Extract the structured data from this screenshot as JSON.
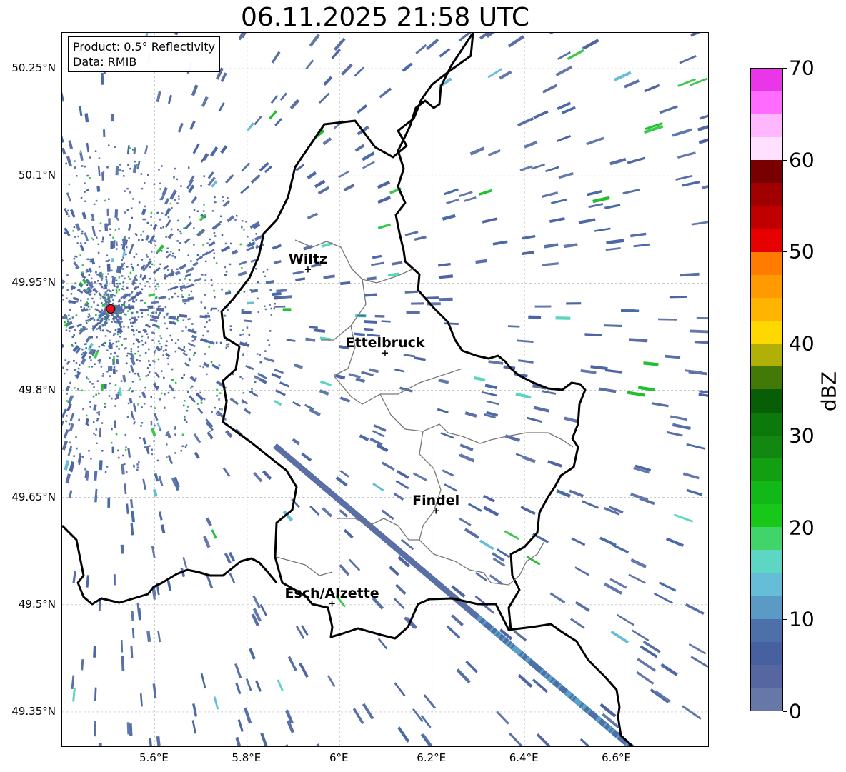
{
  "title": "06.11.2025 21:58 UTC",
  "info": {
    "product": "Product: 0.5° Reflectivity",
    "data": "Data: RMIB"
  },
  "map": {
    "lon_range": [
      5.4,
      6.8
    ],
    "lat_range": [
      49.3,
      50.3
    ],
    "y_ticks": [
      {
        "lat": 50.25,
        "label": "50.25°N"
      },
      {
        "lat": 50.1,
        "label": "50.1°N"
      },
      {
        "lat": 49.95,
        "label": "49.95°N"
      },
      {
        "lat": 49.8,
        "label": "49.8°N"
      },
      {
        "lat": 49.65,
        "label": "49.65°N"
      },
      {
        "lat": 49.5,
        "label": "49.5°N"
      },
      {
        "lat": 49.35,
        "label": "49.35°N"
      }
    ],
    "x_ticks": [
      {
        "lon": 5.6,
        "label": "5.6°E"
      },
      {
        "lon": 5.8,
        "label": "5.8°E"
      },
      {
        "lon": 6.0,
        "label": "6°E"
      },
      {
        "lon": 6.2,
        "label": "6.2°E"
      },
      {
        "lon": 6.4,
        "label": "6.4°E"
      },
      {
        "lon": 6.6,
        "label": "6.6°E"
      }
    ],
    "cities": [
      {
        "name": "Wiltz",
        "lon": 5.933,
        "lat": 49.967
      },
      {
        "name": "Ettelbruck",
        "lon": 6.1,
        "lat": 49.85
      },
      {
        "name": "Findel",
        "lon": 6.21,
        "lat": 49.63
      },
      {
        "name": "Esch/Alzette",
        "lon": 5.985,
        "lat": 49.5
      }
    ],
    "radar_site": {
      "lon": 5.505,
      "lat": 49.914,
      "color": "#e8101a"
    }
  },
  "colorbar": {
    "label": "dBZ",
    "ticks": [
      "0",
      "10",
      "20",
      "30",
      "40",
      "50",
      "60",
      "70"
    ],
    "min": 0,
    "max": 70,
    "colors": [
      "#6677a8",
      "#5566a0",
      "#4760a0",
      "#4d70a8",
      "#5a9ac4",
      "#66bdd8",
      "#5dd6c4",
      "#40d46a",
      "#18c818",
      "#12b818",
      "#12a012",
      "#128812",
      "#0b7a0b",
      "#075e07",
      "#437a07",
      "#b0b008",
      "#ffd800",
      "#ffb400",
      "#ff9a00",
      "#ff7c00",
      "#e60000",
      "#c00000",
      "#a00000",
      "#780000",
      "#ffe0ff",
      "#ffb8ff",
      "#ff6cff",
      "#e836e8"
    ]
  }
}
